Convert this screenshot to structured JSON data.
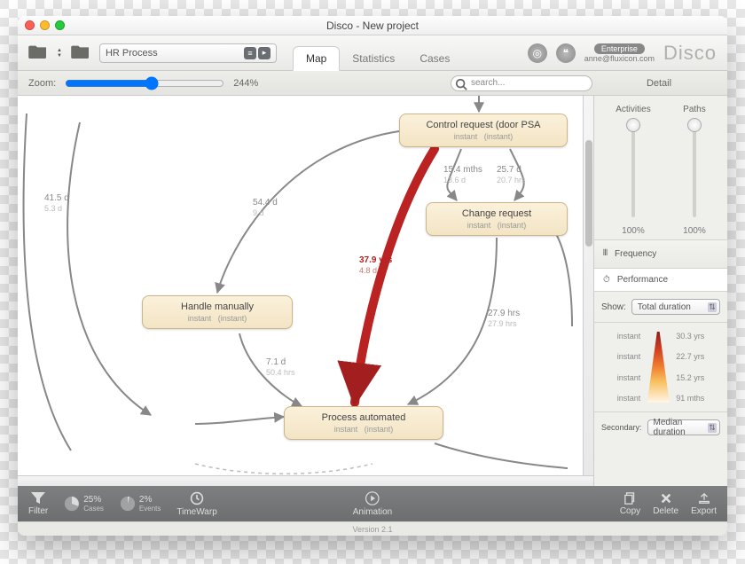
{
  "window_title": "Disco - New project",
  "toolbar": {
    "project": "HR Process",
    "tabs": [
      "Map",
      "Statistics",
      "Cases"
    ],
    "active_tab": "Map",
    "badge": "Enterprise",
    "user_email": "anne@fluxicon.com",
    "logo": "Disco"
  },
  "subbar": {
    "zoom_label": "Zoom:",
    "zoom_value": "244%",
    "search_placeholder": "search...",
    "detail_label": "Detail"
  },
  "map": {
    "nodes": {
      "control": {
        "title": "Control request  (door PSA",
        "sub1": "instant",
        "sub2": "(instant)"
      },
      "change": {
        "title": "Change request",
        "sub1": "instant",
        "sub2": "(instant)"
      },
      "handle": {
        "title": "Handle manually",
        "sub1": "instant",
        "sub2": "(instant)"
      },
      "automated": {
        "title": "Process automated",
        "sub1": "instant",
        "sub2": "(instant)"
      }
    },
    "edges": {
      "e1": {
        "l1": "41.5 d",
        "l2": "5.3 d"
      },
      "e2": {
        "l1": "54.4 d",
        "l2": "9 d"
      },
      "e3": {
        "l1": "15.4 mths",
        "l2": "13.6 d"
      },
      "e4": {
        "l1": "25.7 d",
        "l2": "20.7 hrs"
      },
      "e5": {
        "l1": "37.9 yrs",
        "l2": "4.8 d"
      },
      "e6": {
        "l1": "27.9 hrs",
        "l2": "27.9 hrs"
      },
      "e7": {
        "l1": "7.1 d",
        "l2": "50.4 hrs"
      }
    }
  },
  "side": {
    "activities_label": "Activities",
    "paths_label": "Paths",
    "activities_pct": "100%",
    "paths_pct": "100%",
    "frequency_label": "Frequency",
    "performance_label": "Performance",
    "show_label": "Show:",
    "show_value": "Total duration",
    "gradient_left": [
      "instant",
      "instant",
      "instant",
      "instant"
    ],
    "gradient_right": [
      "30.3 yrs",
      "22.7 yrs",
      "15.2 yrs",
      "91 mths"
    ],
    "secondary_label": "Secondary:",
    "secondary_value": "Median duration"
  },
  "footer": {
    "filter": "Filter",
    "cases_pct": "25%",
    "cases_lbl": "Cases",
    "events_pct": "2%",
    "events_lbl": "Events",
    "timewarp": "TimeWarp",
    "animation": "Animation",
    "copy": "Copy",
    "delete": "Delete",
    "export": "Export"
  },
  "version": "Version 2.1"
}
